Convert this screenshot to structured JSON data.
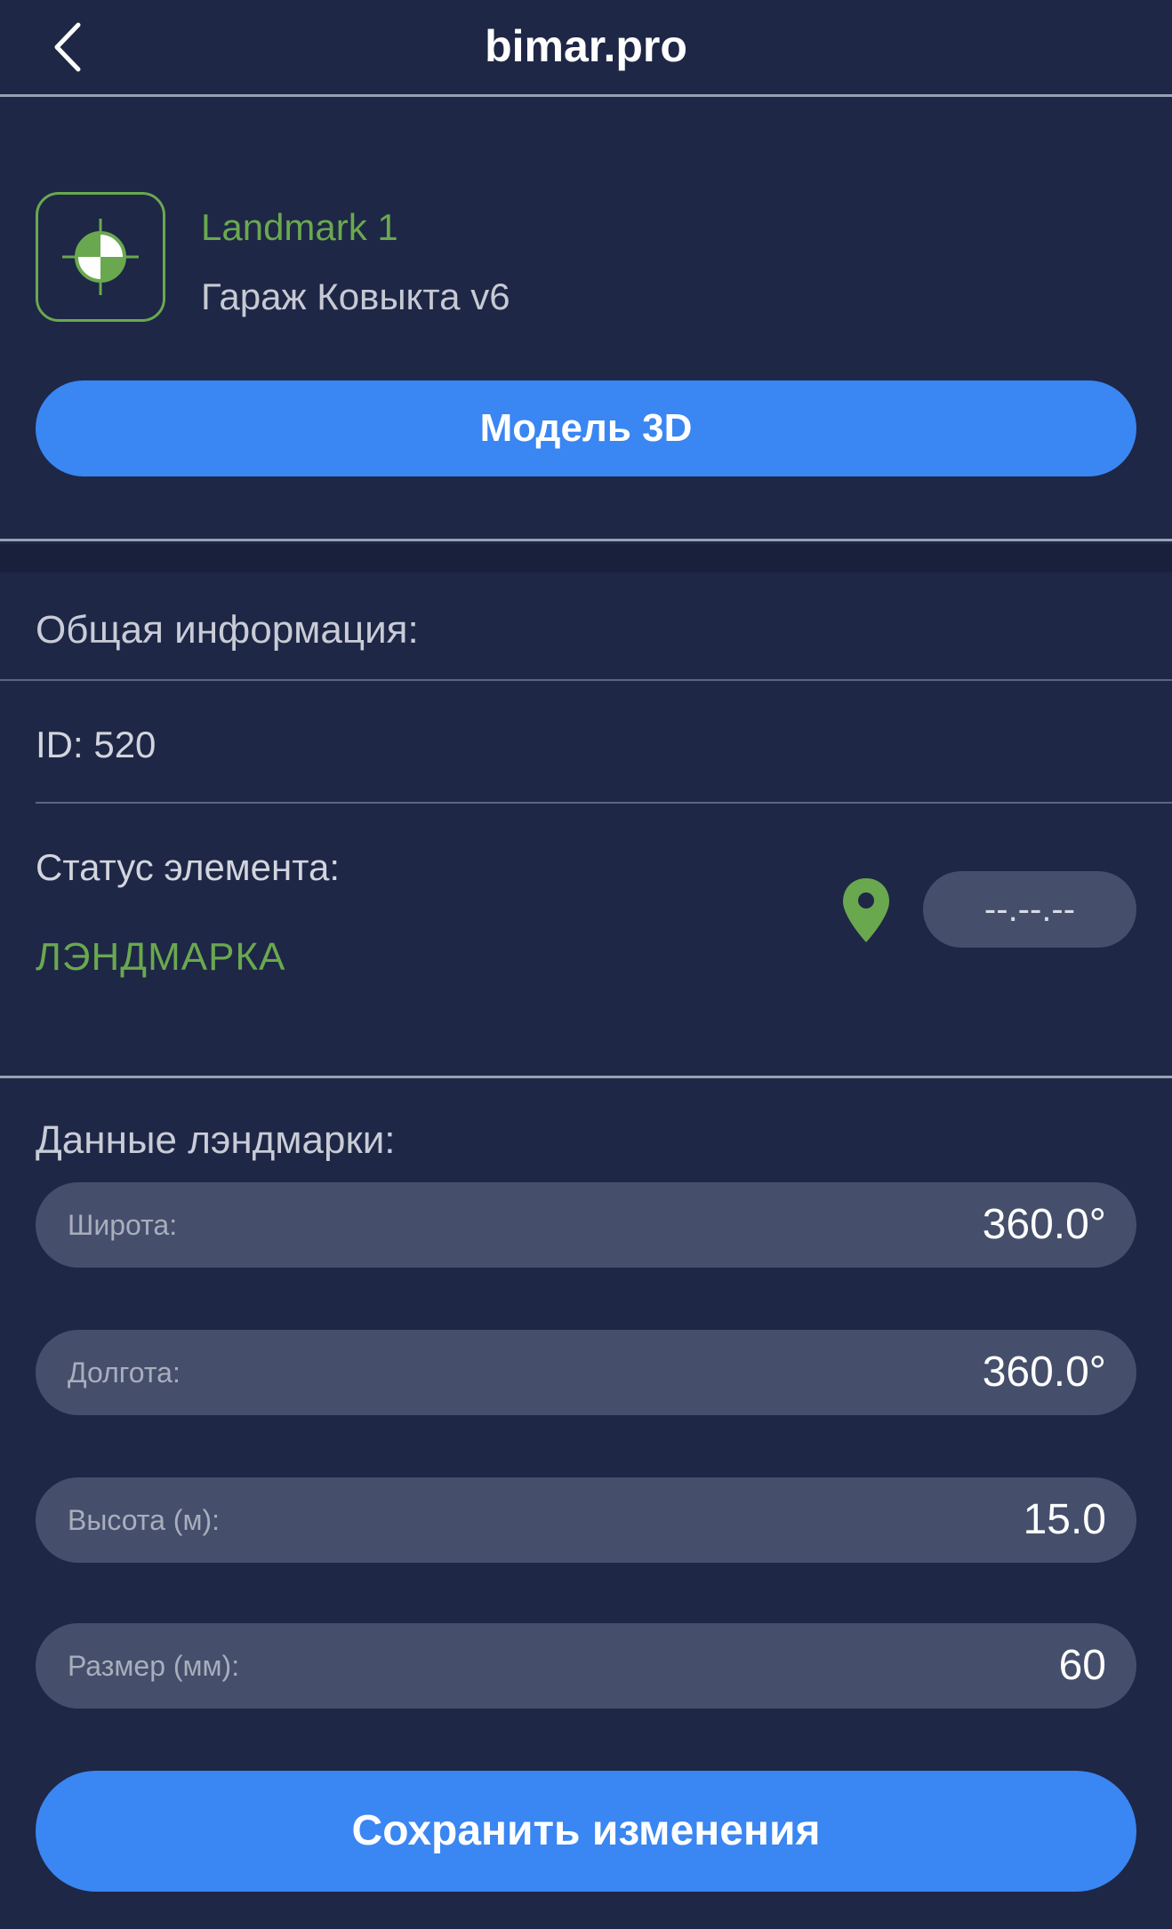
{
  "header": {
    "title": "bimar.pro",
    "back_icon": "chevron-left-icon"
  },
  "element": {
    "icon": "landmark-target-icon",
    "name": "Landmark 1",
    "project": "Гараж Ковыкта v6"
  },
  "model_button_label": "Модель 3D",
  "general_info": {
    "title": "Общая информация:",
    "id_text": "ID: 520",
    "status_label": "Статус элемента:",
    "status_value": "ЛЭНДМАРКА",
    "status_icon": "location-pin-icon",
    "date_value": "--.--.--"
  },
  "landmark_data": {
    "title": "Данные лэндмарки:",
    "fields": [
      {
        "label": "Широта:",
        "value": "360.0°"
      },
      {
        "label": "Долгота:",
        "value": "360.0°"
      },
      {
        "label": "Высота (м):",
        "value": "15.0"
      },
      {
        "label": "Размер (мм):",
        "value": "60"
      }
    ]
  },
  "save_button_label": "Сохранить изменения",
  "colors": {
    "background": "#1e2746",
    "accent_blue": "#3a86f2",
    "accent_green": "#6aa84f",
    "field_bg": "#454f6b"
  }
}
